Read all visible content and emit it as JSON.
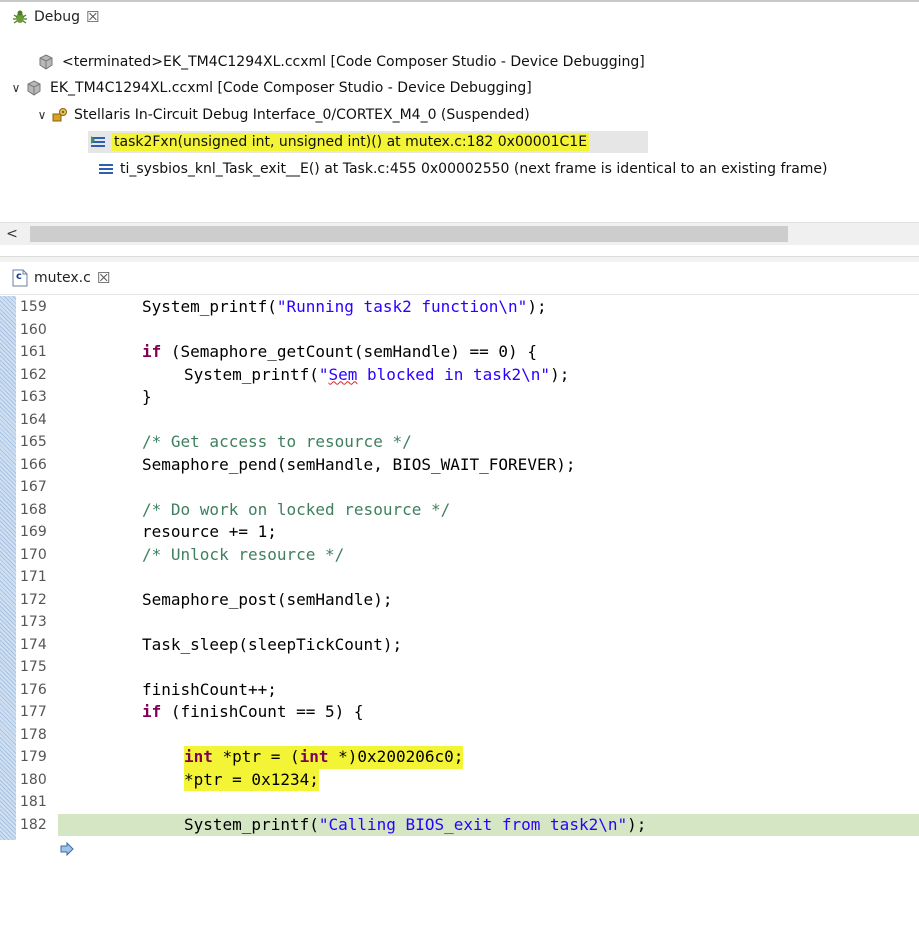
{
  "debug": {
    "tab_label": "Debug",
    "tree": [
      {
        "label": "<terminated>EK_TM4C1294XL.ccxml [Code Composer Studio - Device Debugging]"
      },
      {
        "label": "EK_TM4C1294XL.ccxml [Code Composer Studio - Device Debugging]"
      },
      {
        "label": "Stellaris In-Circuit Debug Interface_0/CORTEX_M4_0 (Suspended)"
      },
      {
        "label": "task2Fxn(unsigned int, unsigned int)() at mutex.c:182 0x00001C1E"
      },
      {
        "label": "ti_sysbios_knl_Task_exit__E() at Task.c:455 0x00002550  (next frame is identical to an existing frame)"
      }
    ]
  },
  "editor": {
    "tab_label": "mutex.c",
    "file_icon_letter": "c",
    "lines": [
      {
        "n": "159",
        "t": "System_printf(\"Running task2 function\\n\");"
      },
      {
        "n": "160"
      },
      {
        "n": "161",
        "t": "if (Semaphore_getCount(semHandle) == 0) {"
      },
      {
        "n": "162",
        "t": "System_printf(\"Sem blocked in task2\\n\");"
      },
      {
        "n": "163",
        "t": "}"
      },
      {
        "n": "164"
      },
      {
        "n": "165",
        "t": "/* Get access to resource */"
      },
      {
        "n": "166",
        "t": "Semaphore_pend(semHandle, BIOS_WAIT_FOREVER);"
      },
      {
        "n": "167"
      },
      {
        "n": "168",
        "t": "/* Do work on locked resource */"
      },
      {
        "n": "169",
        "t": "resource += 1;"
      },
      {
        "n": "170",
        "t": "/* Unlock resource */"
      },
      {
        "n": "171"
      },
      {
        "n": "172",
        "t": "Semaphore_post(semHandle);"
      },
      {
        "n": "173"
      },
      {
        "n": "174",
        "t": "Task_sleep(sleepTickCount);"
      },
      {
        "n": "175"
      },
      {
        "n": "176",
        "t": "finishCount++;"
      },
      {
        "n": "177",
        "t": "if (finishCount == 5) {"
      },
      {
        "n": "178"
      },
      {
        "n": "179",
        "t": "int *ptr = (int *)0x200206c0;"
      },
      {
        "n": "180",
        "t": "*ptr = 0x1234;"
      },
      {
        "n": "181"
      },
      {
        "n": "182",
        "t": "System_printf(\"Calling BIOS_exit from task2\\n\");"
      }
    ]
  },
  "colors": {
    "keyword": "#7f0055",
    "string": "#2a00ff",
    "comment": "#3f7f5f",
    "highlight": "#f4f437",
    "current_line": "#d4e6c4"
  }
}
